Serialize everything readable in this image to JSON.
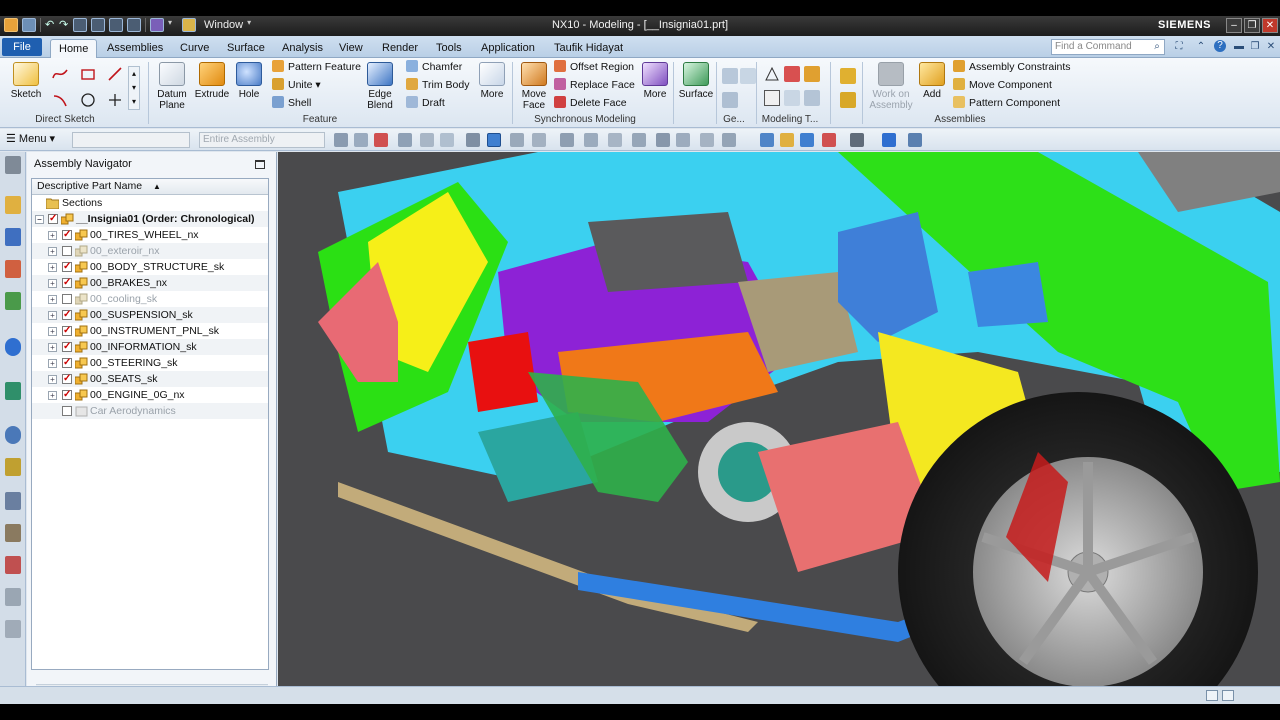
{
  "window": {
    "title": "NX10 - Modeling - [__Insignia01.prt]",
    "brand": "SIEMENS",
    "window_menu": "Window"
  },
  "ribbon_tabs": {
    "file": "File",
    "items": [
      "Home",
      "Assemblies",
      "Curve",
      "Surface",
      "Analysis",
      "View",
      "Render",
      "Tools",
      "Application",
      "Taufik Hidayat"
    ],
    "active": "Home",
    "find_placeholder": "Find a Command"
  },
  "ribbon": {
    "direct_sketch": {
      "label": "Direct Sketch",
      "sketch": "Sketch"
    },
    "feature": {
      "label": "Feature",
      "datum_plane": "Datum\nPlane",
      "extrude": "Extrude",
      "hole": "Hole",
      "pattern_feature": "Pattern Feature",
      "unite": "Unite",
      "shell": "Shell",
      "edge_blend": "Edge\nBlend",
      "chamfer": "Chamfer",
      "trim_body": "Trim Body",
      "draft": "Draft",
      "more": "More"
    },
    "synchronous": {
      "label": "Synchronous Modeling",
      "move_face": "Move\nFace",
      "offset_region": "Offset Region",
      "replace_face": "Replace Face",
      "delete_face": "Delete Face",
      "more": "More"
    },
    "surface": {
      "label": "Surface"
    },
    "ge_group": {
      "label": "Ge..."
    },
    "modeling_t": {
      "label": "Modeling T..."
    },
    "assemblies": {
      "label": "Assemblies",
      "work_on_assembly": "Work on\nAssembly",
      "add": "Add",
      "assembly_constraints": "Assembly Constraints",
      "move_component": "Move Component",
      "pattern_component": "Pattern Component"
    }
  },
  "toolbar": {
    "menu": "Menu",
    "filter_combo": "",
    "scope_combo": "Entire Assembly"
  },
  "navigator": {
    "title": "Assembly Navigator",
    "column_header": "Descriptive Part Name",
    "rows": [
      {
        "label": "Sections",
        "checked": null,
        "dim": false
      },
      {
        "label": "__Insignia01 (Order: Chronological)",
        "checked": true,
        "dim": false
      },
      {
        "label": "00_TIRES_WHEEL_nx",
        "checked": true,
        "dim": false
      },
      {
        "label": "00_exteroir_nx",
        "checked": false,
        "dim": true
      },
      {
        "label": "00_BODY_STRUCTURE_sk",
        "checked": true,
        "dim": false
      },
      {
        "label": "00_BRAKES_nx",
        "checked": true,
        "dim": false
      },
      {
        "label": "00_cooling_sk",
        "checked": false,
        "dim": true
      },
      {
        "label": "00_SUSPENSION_sk",
        "checked": true,
        "dim": false
      },
      {
        "label": "00_INSTRUMENT_PNL_sk",
        "checked": true,
        "dim": false
      },
      {
        "label": "00_INFORMATION_sk",
        "checked": true,
        "dim": false
      },
      {
        "label": "00_STEERING_sk",
        "checked": true,
        "dim": false
      },
      {
        "label": "00_SEATS_sk",
        "checked": true,
        "dim": false
      },
      {
        "label": "00_ENGINE_0G_nx",
        "checked": true,
        "dim": false
      },
      {
        "label": "Car Aerodynamics",
        "checked": false,
        "dim": true
      }
    ]
  },
  "colors": {
    "accent": "#1f5fb0",
    "viewport_bg": "#4a4a4c"
  }
}
